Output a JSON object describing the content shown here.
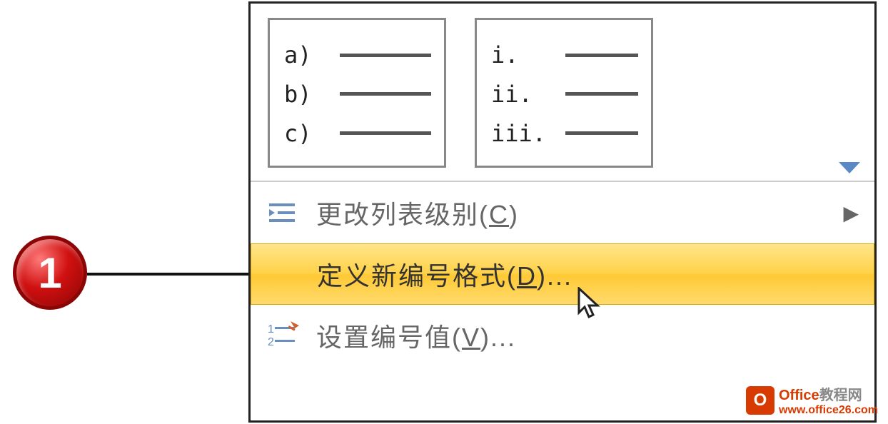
{
  "gallery": {
    "item1": {
      "r1": "a)",
      "r2": "b)",
      "r3": "c)"
    },
    "item2": {
      "r1": "i.",
      "r2": "ii.",
      "r3": "iii."
    }
  },
  "menu": {
    "changeListLevel": {
      "pre": "更改列表级别(",
      "key": "C",
      "post": ")"
    },
    "defineNewFormat": {
      "pre": "定义新编号格式(",
      "key": "D",
      "post": ")..."
    },
    "setNumberValue": {
      "pre": "设置编号值(",
      "key": "V",
      "post": ")..."
    }
  },
  "callout": {
    "num": "1"
  },
  "watermark": {
    "brand": "Office",
    "site": "教程网",
    "url": "www.office26.com",
    "logo": "O"
  }
}
